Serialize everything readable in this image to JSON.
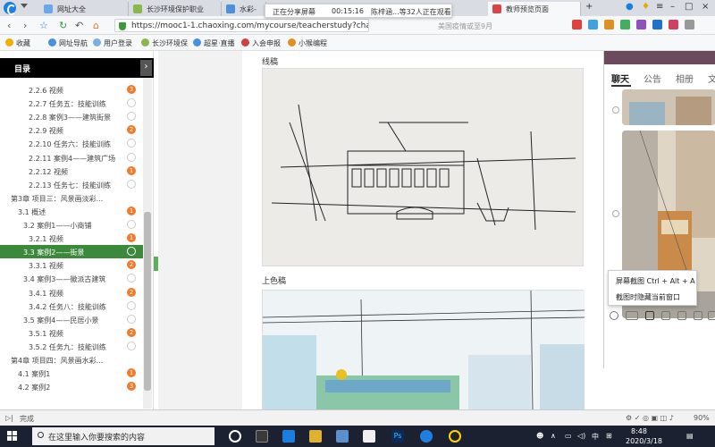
{
  "browser": {
    "tabs": [
      {
        "label": "网址大全",
        "active": false
      },
      {
        "label": "长沙环境保护职业",
        "active": false
      },
      {
        "label": "水彩-",
        "active": false
      },
      {
        "label": "教师预览页面",
        "active": true
      }
    ],
    "url": "https://mooc1-1.chaoxing.com/mycourse/teacherstudy?chapterId=",
    "search_hint": "美国疫情或至9月",
    "share_toast": {
      "status": "正在分享屏幕",
      "time": "00:15:16",
      "viewers": "陈梓涵...等32人正在观看"
    }
  },
  "bookmarks": [
    "收藏",
    "网址导航",
    "用户登录",
    "长沙环境保",
    "超星·直播",
    "入会申报",
    "小猴编程"
  ],
  "sidebar": {
    "title": "目录",
    "items": [
      {
        "label": "2.2.6 视频",
        "badge": "3",
        "badge_type": "orange"
      },
      {
        "label": "2.2.7 任务五：技能训练",
        "badge": "",
        "badge_type": "empty"
      },
      {
        "label": "2.2.8 案例3——建筑街景",
        "badge": "",
        "badge_type": "empty"
      },
      {
        "label": "2.2.9 视频",
        "badge": "2",
        "badge_type": "orange"
      },
      {
        "label": "2.2.10 任务六：技能训练",
        "badge": "",
        "badge_type": "empty"
      },
      {
        "label": "2.2.11 案例4——建筑广场",
        "badge": "",
        "badge_type": "empty"
      },
      {
        "label": "2.2.12 视频",
        "badge": "1",
        "badge_type": "orange"
      },
      {
        "label": "2.2.13 任务七：技能训练",
        "badge": "",
        "badge_type": "empty"
      },
      {
        "label": "第3章 项目三：风景画淡彩...",
        "badge": "",
        "badge_type": "none"
      },
      {
        "label": "3.1 概述",
        "badge": "1",
        "badge_type": "orange"
      },
      {
        "label": "3.2 案例1——小商铺",
        "badge": "",
        "badge_type": "empty"
      },
      {
        "label": "3.2.1 视频",
        "badge": "1",
        "badge_type": "orange"
      },
      {
        "label": "3.3 案例2——街景",
        "badge": "",
        "badge_type": "empty"
      },
      {
        "label": "3.3.1 视频",
        "badge": "2",
        "badge_type": "orange"
      },
      {
        "label": "3.4 案例3——徽派古建筑",
        "badge": "",
        "badge_type": "empty"
      },
      {
        "label": "3.4.1 视频",
        "badge": "2",
        "badge_type": "orange"
      },
      {
        "label": "3.4.2 任务八：技能训练",
        "badge": "",
        "badge_type": "empty"
      },
      {
        "label": "3.5 案例4——民居小景",
        "badge": "",
        "badge_type": "empty"
      },
      {
        "label": "3.5.1 视频",
        "badge": "2",
        "badge_type": "orange"
      },
      {
        "label": "3.5.2 任务九：技能训练",
        "badge": "",
        "badge_type": "empty"
      },
      {
        "label": "第4章 项目四：风景画水彩...",
        "badge": "",
        "badge_type": "none"
      },
      {
        "label": "4.1 案例1",
        "badge": "1",
        "badge_type": "orange"
      },
      {
        "label": "4.2 案例2",
        "badge": "3",
        "badge_type": "orange"
      }
    ],
    "active_index": 12
  },
  "content": {
    "section1_label": "线稿",
    "section2_label": "上色稿"
  },
  "chat": {
    "tabs": [
      "聊天",
      "公告",
      "相册",
      "文"
    ],
    "menu": [
      "屏幕截图 Ctrl + Alt + A",
      "截图时隐藏当前窗口"
    ]
  },
  "status": {
    "text": "完成",
    "zoom": "90%"
  },
  "taskbar": {
    "search_placeholder": "在这里输入你要搜索的内容",
    "time": "8:48",
    "date": "2020/3/18",
    "ime": "中"
  },
  "colors": {
    "accent_green": "#3b8a3b",
    "badge_orange": "#f07a2a",
    "taskbar": "#1b2130"
  }
}
